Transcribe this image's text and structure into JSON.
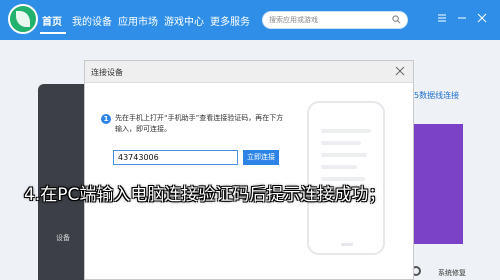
{
  "app": {
    "nav": [
      {
        "label": "首页"
      },
      {
        "label": "我的设备"
      },
      {
        "label": "应用市场"
      },
      {
        "label": "游戏中心"
      },
      {
        "label": "更多服务"
      }
    ],
    "search_placeholder": "搜索应用或游戏",
    "accent_color": "#2f8fe8"
  },
  "background": {
    "device_label": "设备",
    "right_link": "5数据线连接",
    "repair_label": "系统修复"
  },
  "dialog": {
    "title": "连接设备",
    "instruction": "先在手机上打开“手机助手”查看连接验证码，再在下方输入，即可连接。",
    "code_value": "43743006",
    "connect_label": "立即连接"
  },
  "caption": "4.在PC端输入电脑连接验证码后提示连接成功；"
}
